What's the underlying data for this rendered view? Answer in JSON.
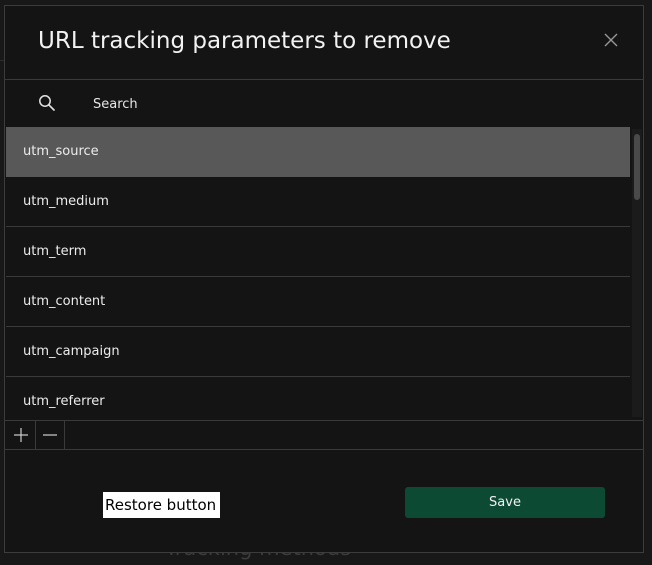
{
  "dialog": {
    "title": "URL tracking parameters to remove",
    "close_icon": "close-icon"
  },
  "search": {
    "placeholder": "Search",
    "value": "",
    "icon": "search-icon"
  },
  "list": {
    "selected_index": 0,
    "items": [
      {
        "label": "utm_source"
      },
      {
        "label": "utm_medium"
      },
      {
        "label": "utm_term"
      },
      {
        "label": "utm_content"
      },
      {
        "label": "utm_campaign"
      },
      {
        "label": "utm_referrer"
      }
    ]
  },
  "toolbar": {
    "add_icon": "plus-icon",
    "remove_icon": "minus-icon"
  },
  "footer": {
    "restore_label": "Restore button",
    "save_label": "Save"
  },
  "background": {
    "bottom_text": "Tracking methods",
    "colors": {
      "accent": "#0c4a34",
      "selected_row": "#585858"
    }
  }
}
